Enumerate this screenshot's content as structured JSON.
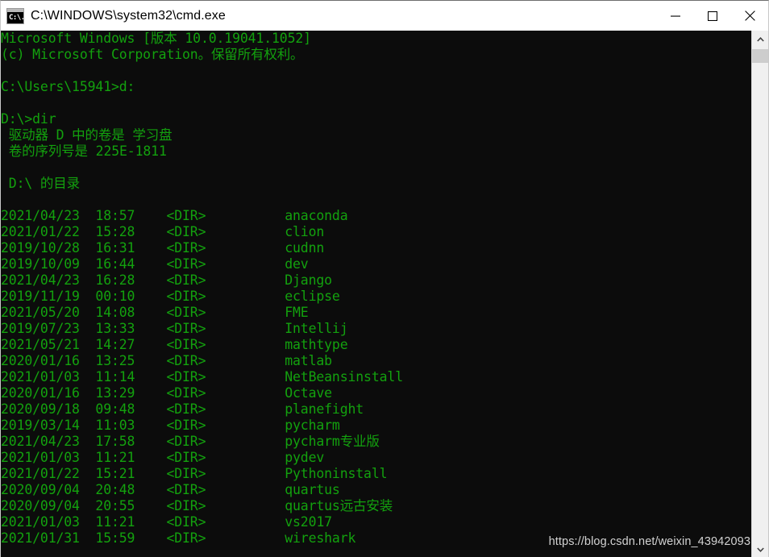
{
  "window": {
    "title": "C:\\WINDOWS\\system32\\cmd.exe",
    "icon_label": "C:\\.",
    "minimize_label": "Minimize",
    "maximize_label": "Maximize",
    "close_label": "Close"
  },
  "console": {
    "foreground_color": "#13a10e",
    "background_color": "#0c0c0c",
    "lines": [
      "Microsoft Windows [版本 10.0.19041.1052]",
      "(c) Microsoft Corporation。保留所有权利。",
      "",
      "C:\\Users\\15941>d:",
      "",
      "D:\\>dir",
      " 驱动器 D 中的卷是 学习盘",
      " 卷的序列号是 225E-1811",
      "",
      " D:\\ 的目录",
      "",
      "2021/04/23  18:57    <DIR>          anaconda",
      "2021/01/22  15:28    <DIR>          clion",
      "2019/10/28  16:31    <DIR>          cudnn",
      "2019/10/09  16:44    <DIR>          dev",
      "2021/04/23  16:28    <DIR>          Django",
      "2019/11/19  00:10    <DIR>          eclipse",
      "2021/05/20  14:08    <DIR>          FME",
      "2019/07/23  13:33    <DIR>          Intellij",
      "2021/05/21  14:27    <DIR>          mathtype",
      "2020/01/16  13:25    <DIR>          matlab",
      "2021/01/03  11:14    <DIR>          NetBeansinstall",
      "2020/01/16  13:29    <DIR>          Octave",
      "2020/09/18  09:48    <DIR>          planefight",
      "2019/03/14  11:03    <DIR>          pycharm",
      "2021/04/23  17:58    <DIR>          pycharm专业版",
      "2021/01/03  11:21    <DIR>          pydev",
      "2021/01/22  15:21    <DIR>          Pythoninstall",
      "2020/09/04  20:48    <DIR>          quartus",
      "2020/09/04  20:55    <DIR>          quartus远古安装",
      "2021/01/03  11:21    <DIR>          vs2017",
      "2021/01/31  15:59    <DIR>          wireshark"
    ]
  },
  "watermark": {
    "text": "https://blog.csdn.net/weixin_43942093"
  },
  "scrollbar": {
    "up_arrow_label": "Scroll up",
    "down_arrow_label": "Scroll down"
  }
}
